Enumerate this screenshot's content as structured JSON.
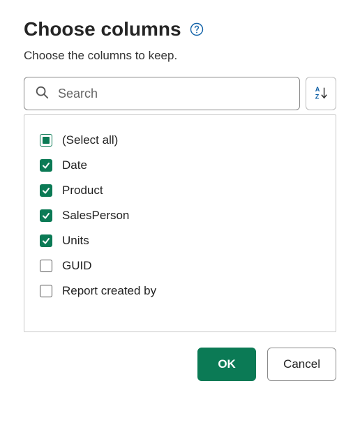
{
  "title": "Choose columns",
  "subtitle": "Choose the columns to keep.",
  "search": {
    "placeholder": "Search",
    "value": ""
  },
  "columns": [
    {
      "id": "select-all",
      "label": "(Select all)",
      "state": "indeterminate"
    },
    {
      "id": "date",
      "label": "Date",
      "state": "checked"
    },
    {
      "id": "product",
      "label": "Product",
      "state": "checked"
    },
    {
      "id": "salesperson",
      "label": "SalesPerson",
      "state": "checked"
    },
    {
      "id": "units",
      "label": "Units",
      "state": "checked"
    },
    {
      "id": "guid",
      "label": "GUID",
      "state": "unchecked"
    },
    {
      "id": "report-created-by",
      "label": "Report created by",
      "state": "unchecked"
    }
  ],
  "buttons": {
    "ok": "OK",
    "cancel": "Cancel"
  },
  "colors": {
    "accent": "#0b7a55",
    "help": "#0d5fa6"
  }
}
